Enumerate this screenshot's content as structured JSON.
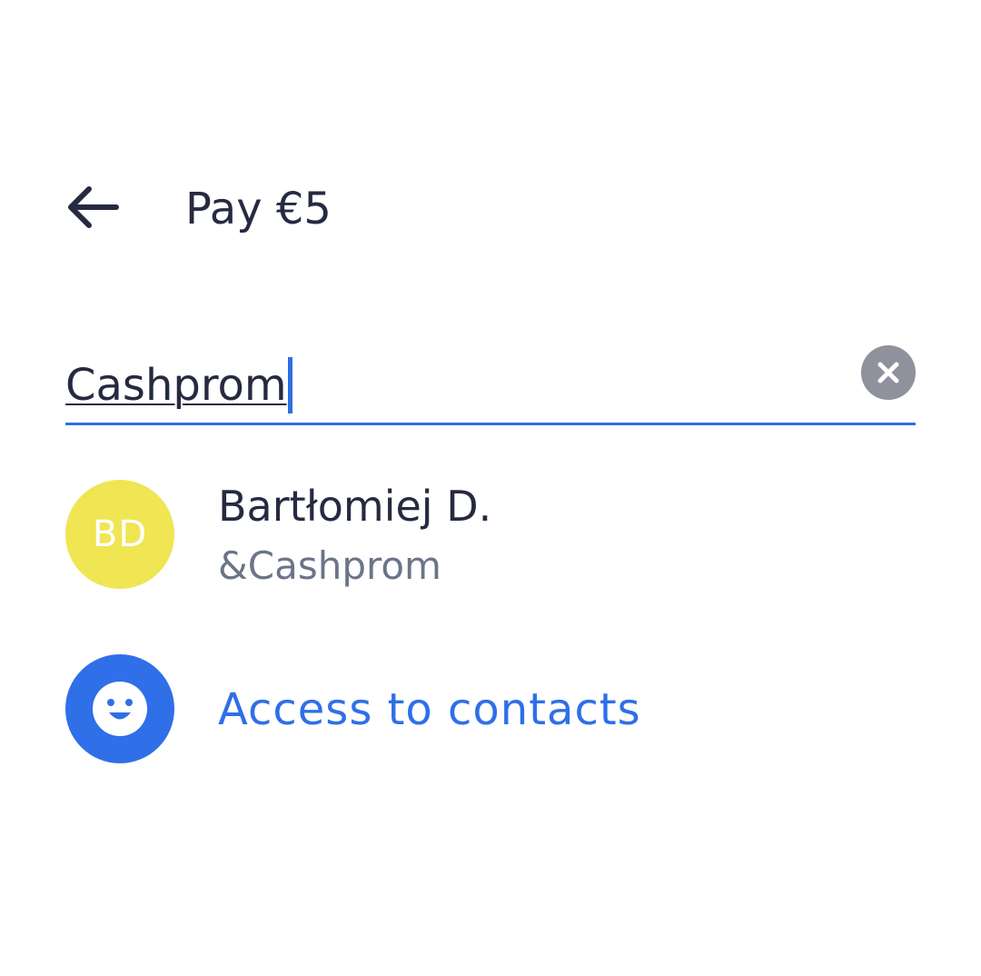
{
  "header": {
    "back_icon": "arrow-left-icon",
    "title": "Pay €5"
  },
  "search": {
    "value": "Cashprom",
    "clear_icon": "close-icon"
  },
  "results": [
    {
      "initials": "BD",
      "name": "Bartłomiej D.",
      "handle": "&Cashprom"
    }
  ],
  "contacts_access": {
    "icon": "smiley-face-icon",
    "label": "Access to contacts"
  },
  "colors": {
    "text_primary": "#262a41",
    "text_secondary": "#6b7588",
    "accent_blue": "#2f6fe8",
    "avatar_yellow": "#f0e553",
    "clear_grey": "#8f919c"
  }
}
